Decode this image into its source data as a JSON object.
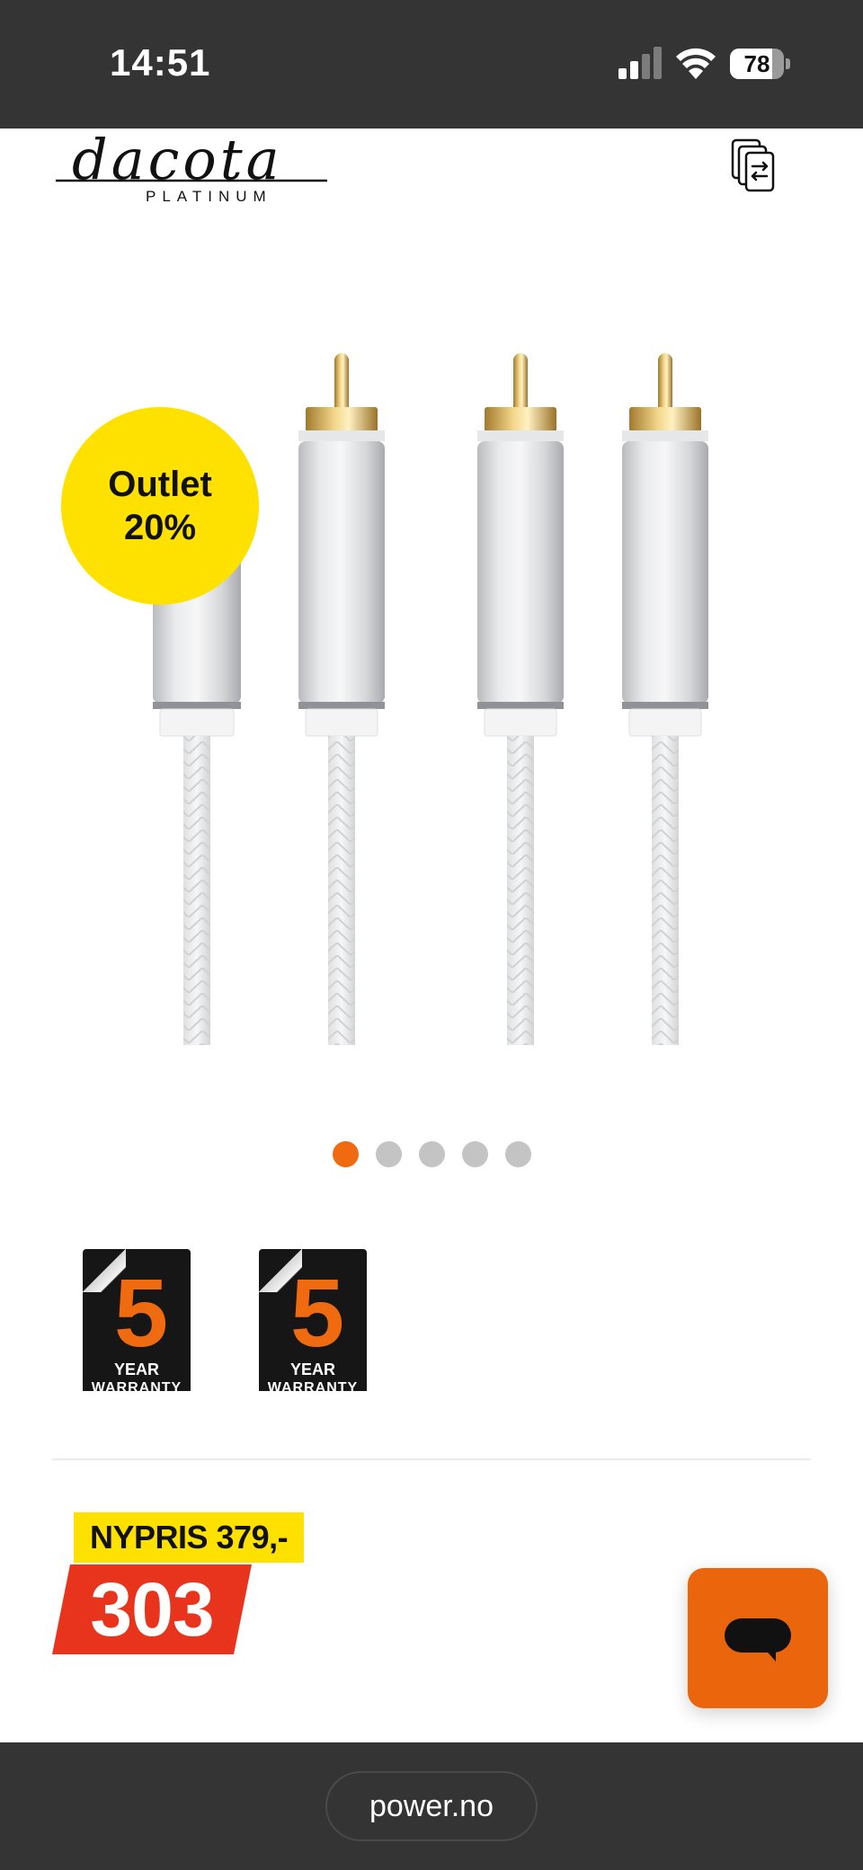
{
  "status_bar": {
    "time": "14:51",
    "battery_level": "78",
    "battery_fraction": 0.78,
    "icons": [
      "cellular-signal-icon",
      "wifi-icon",
      "battery-icon"
    ]
  },
  "header": {
    "logo_text": "dacota",
    "logo_subtext": "PLATINUM",
    "compare_icon": "compare-icon"
  },
  "gallery": {
    "badge_line1": "Outlet",
    "badge_line2": "20%",
    "badge_color": "#ffe100",
    "total_images": 5,
    "active_index": 0,
    "active_dot_color": "#f06a0f",
    "inactive_dot_color": "#c4c4c4"
  },
  "warranty_badges": [
    {
      "number": "5",
      "label": "YEAR",
      "sublabel": "WARRANTY"
    },
    {
      "number": "5",
      "label": "YEAR",
      "sublabel": "WARRANTY"
    }
  ],
  "price": {
    "old_price": "NYPRIS 379,-",
    "current_price": "303",
    "old_price_bg": "#ffe100",
    "current_price_bg": "#e8341c"
  },
  "chat": {
    "icon": "chat-bubble-icon",
    "color": "#eb650d"
  },
  "browser": {
    "url": "power.no"
  }
}
